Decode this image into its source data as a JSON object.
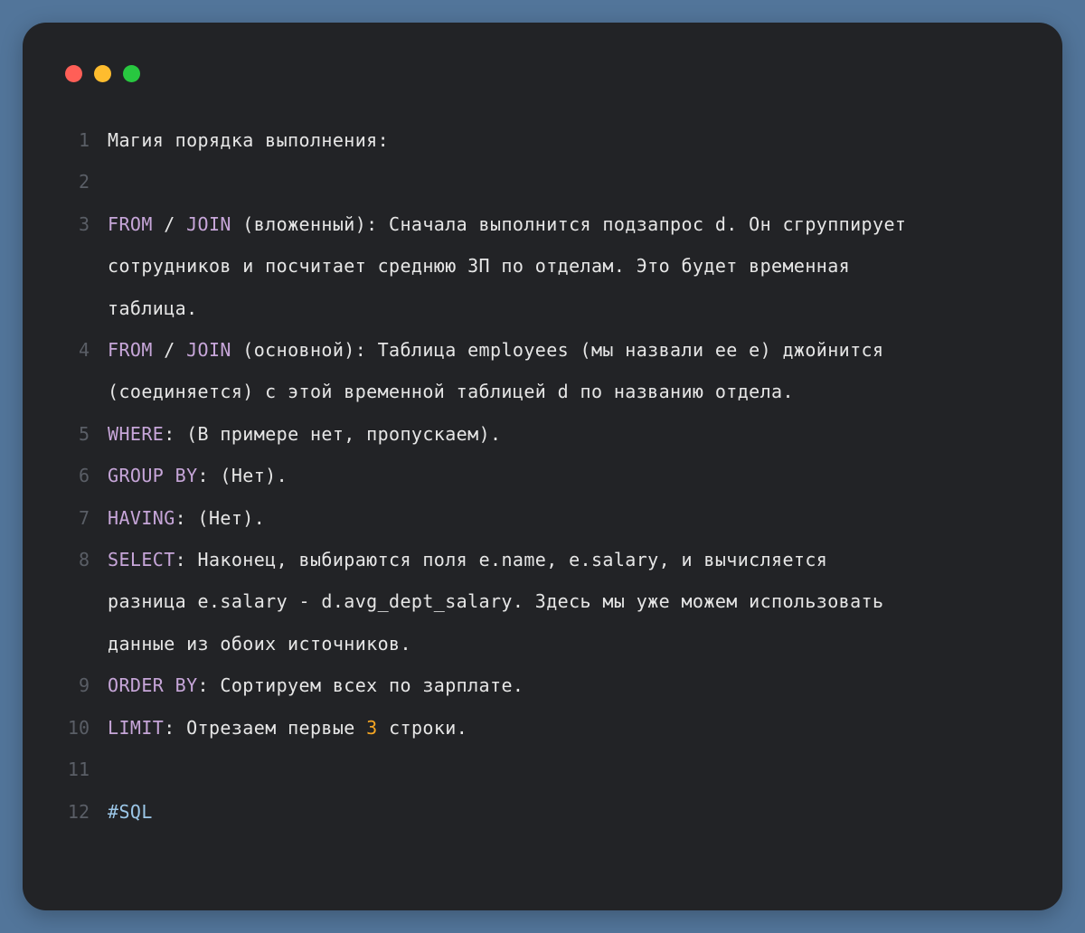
{
  "window": {
    "controls": {
      "close_color": "#ff5f57",
      "minimize_color": "#febc2e",
      "maximize_color": "#28c840"
    }
  },
  "colors": {
    "keyword": "#c7a6d9",
    "number": "#f5a623",
    "tag": "#9cc7e8",
    "text": "#e6e6e6",
    "line_number": "#5a5e66",
    "background": "#222326",
    "page_background": "#52759a"
  },
  "code": {
    "lines": [
      {
        "number": "1",
        "segments": [
          {
            "type": "text",
            "text": "Магия порядка выполнения:"
          }
        ]
      },
      {
        "number": "2",
        "segments": []
      },
      {
        "number": "3",
        "segments": [
          {
            "type": "keyword",
            "text": "FROM"
          },
          {
            "type": "text",
            "text": " / "
          },
          {
            "type": "keyword",
            "text": "JOIN"
          },
          {
            "type": "text",
            "text": " (вложенный): Сначала выполнится подзапрос d. Он сгруппирует\nсотрудников и посчитает среднюю ЗП по отделам. Это будет временная\nтаблица."
          }
        ]
      },
      {
        "number": "4",
        "segments": [
          {
            "type": "keyword",
            "text": "FROM"
          },
          {
            "type": "text",
            "text": " / "
          },
          {
            "type": "keyword",
            "text": "JOIN"
          },
          {
            "type": "text",
            "text": " (основной): Таблица employees (мы назвали ее e) джойнится\n(соединяется) с этой временной таблицей d по названию отдела."
          }
        ]
      },
      {
        "number": "5",
        "segments": [
          {
            "type": "keyword",
            "text": "WHERE"
          },
          {
            "type": "text",
            "text": ": (В примере нет, пропускаем)."
          }
        ]
      },
      {
        "number": "6",
        "segments": [
          {
            "type": "keyword",
            "text": "GROUP BY"
          },
          {
            "type": "text",
            "text": ": (Нет)."
          }
        ]
      },
      {
        "number": "7",
        "segments": [
          {
            "type": "keyword",
            "text": "HAVING"
          },
          {
            "type": "text",
            "text": ": (Нет)."
          }
        ]
      },
      {
        "number": "8",
        "segments": [
          {
            "type": "keyword",
            "text": "SELECT"
          },
          {
            "type": "text",
            "text": ": Наконец, выбираются поля e.name, e.salary, и вычисляется\nразница e.salary - d.avg_dept_salary. Здесь мы уже можем использовать\nданные из обоих источников."
          }
        ]
      },
      {
        "number": "9",
        "segments": [
          {
            "type": "keyword",
            "text": "ORDER BY"
          },
          {
            "type": "text",
            "text": ": Сортируем всех по зарплате."
          }
        ]
      },
      {
        "number": "10",
        "segments": [
          {
            "type": "keyword",
            "text": "LIMIT"
          },
          {
            "type": "text",
            "text": ": Отрезаем первые "
          },
          {
            "type": "number",
            "text": "3"
          },
          {
            "type": "text",
            "text": " строки."
          }
        ]
      },
      {
        "number": "11",
        "segments": []
      },
      {
        "number": "12",
        "segments": [
          {
            "type": "tag",
            "text": "#SQL"
          }
        ]
      }
    ]
  }
}
